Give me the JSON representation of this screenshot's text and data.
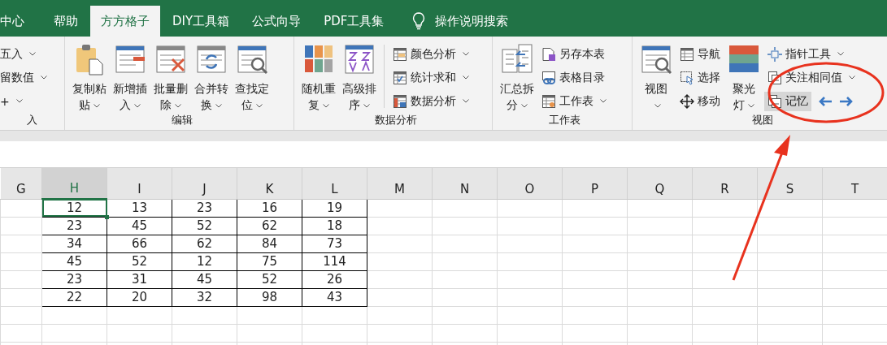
{
  "tabs": [
    {
      "label": "中心",
      "selected": false
    },
    {
      "label": "帮助",
      "selected": false
    },
    {
      "label": "方方格子",
      "selected": true
    },
    {
      "label": "DIY工具箱",
      "selected": false
    },
    {
      "label": "公式向导",
      "selected": false
    },
    {
      "label": "PDF工具集",
      "selected": false
    }
  ],
  "search": {
    "label": "操作说明搜索"
  },
  "ribbon_groups": [
    {
      "label": "入",
      "columns": [
        {
          "kind": "stack",
          "items": [
            {
              "label": "五入",
              "dropdown": true
            },
            {
              "label": "留数值",
              "dropdown": true
            },
            {
              "label": "+",
              "dropdown": true
            }
          ]
        }
      ]
    },
    {
      "label": "编辑",
      "columns": [
        {
          "kind": "large",
          "lines": [
            "复制粘",
            "贴"
          ],
          "dropdown": true
        },
        {
          "kind": "large",
          "lines": [
            "新增插",
            "入"
          ],
          "dropdown": true
        },
        {
          "kind": "large",
          "lines": [
            "批量删",
            "除"
          ],
          "dropdown": true
        },
        {
          "kind": "large",
          "lines": [
            "合并转",
            "换"
          ],
          "dropdown": true
        },
        {
          "kind": "large",
          "lines": [
            "查找定",
            "位"
          ],
          "dropdown": true
        }
      ]
    },
    {
      "label": "数据分析",
      "columns": [
        {
          "kind": "large",
          "lines": [
            "随机重",
            "复"
          ],
          "dropdown": true
        },
        {
          "kind": "large",
          "lines": [
            "高级排",
            "序"
          ],
          "dropdown": true
        },
        {
          "kind": "separator"
        },
        {
          "kind": "stack",
          "items": [
            {
              "label": "颜色分析",
              "dropdown": true
            },
            {
              "label": "统计求和",
              "dropdown": true
            },
            {
              "label": "数据分析",
              "dropdown": true
            }
          ]
        }
      ]
    },
    {
      "label": "工作表",
      "columns": [
        {
          "kind": "large",
          "lines": [
            "汇总拆",
            "分"
          ],
          "dropdown": true
        },
        {
          "kind": "stack",
          "items": [
            {
              "label": "另存本表",
              "dropdown": false
            },
            {
              "label": "表格目录",
              "dropdown": false
            },
            {
              "label": "工作表",
              "dropdown": true
            }
          ]
        }
      ]
    },
    {
      "label": "视图",
      "columns": [
        {
          "kind": "large",
          "lines": [
            "视图"
          ],
          "dropdown": true
        },
        {
          "kind": "stack",
          "items": [
            {
              "label": "导航",
              "dropdown": false
            },
            {
              "label": "选择",
              "dropdown": false
            },
            {
              "label": "移动",
              "dropdown": false
            }
          ]
        },
        {
          "kind": "large",
          "lines": [
            "聚光",
            "灯"
          ],
          "dropdown": true
        },
        {
          "kind": "stack",
          "items": [
            {
              "label": "指针工具",
              "dropdown": true,
              "highlighted": false
            },
            {
              "label": "关注相同值",
              "dropdown": true,
              "highlighted": false
            },
            {
              "label": "记忆",
              "dropdown": false,
              "highlighted": true,
              "nav_arrows": true
            }
          ]
        }
      ]
    }
  ],
  "annotation": {
    "kind": "circle-and-arrow"
  },
  "sheet": {
    "columns": [
      {
        "label": "G",
        "selected": false
      },
      {
        "label": "H",
        "selected": true
      },
      {
        "label": "I",
        "selected": false
      },
      {
        "label": "J",
        "selected": false
      },
      {
        "label": "K",
        "selected": false
      },
      {
        "label": "L",
        "selected": false
      },
      {
        "label": "M",
        "selected": false
      },
      {
        "label": "N",
        "selected": false
      },
      {
        "label": "O",
        "selected": false
      },
      {
        "label": "P",
        "selected": false
      },
      {
        "label": "Q",
        "selected": false
      },
      {
        "label": "R",
        "selected": false
      },
      {
        "label": "S",
        "selected": false
      },
      {
        "label": "T",
        "selected": false
      }
    ],
    "rows": [
      {
        "cells": [
          {
            "selected": false
          },
          {
            "value": "12",
            "selected": true
          },
          {
            "value": "13",
            "selected": false
          },
          {
            "value": "23",
            "selected": false
          },
          {
            "value": "16",
            "selected": false
          },
          {
            "value": "19",
            "selected": false
          }
        ]
      },
      {
        "cells": [
          {
            "selected": false
          },
          {
            "value": "23",
            "selected": false
          },
          {
            "value": "45",
            "selected": false
          },
          {
            "value": "52",
            "selected": false
          },
          {
            "value": "62",
            "selected": false
          },
          {
            "value": "18",
            "selected": false
          }
        ]
      },
      {
        "cells": [
          {
            "selected": false
          },
          {
            "value": "34",
            "selected": false
          },
          {
            "value": "66",
            "selected": false
          },
          {
            "value": "62",
            "selected": false
          },
          {
            "value": "84",
            "selected": false
          },
          {
            "value": "73",
            "selected": false
          }
        ]
      },
      {
        "cells": [
          {
            "selected": false
          },
          {
            "value": "45",
            "selected": false
          },
          {
            "value": "52",
            "selected": false
          },
          {
            "value": "12",
            "selected": false
          },
          {
            "value": "75",
            "selected": false
          },
          {
            "value": "114",
            "selected": false
          }
        ]
      },
      {
        "cells": [
          {
            "selected": false
          },
          {
            "value": "23",
            "selected": false
          },
          {
            "value": "31",
            "selected": false
          },
          {
            "value": "45",
            "selected": false
          },
          {
            "value": "52",
            "selected": false
          },
          {
            "value": "26",
            "selected": false
          }
        ]
      },
      {
        "cells": [
          {
            "selected": false
          },
          {
            "value": "22",
            "selected": false
          },
          {
            "value": "20",
            "selected": false
          },
          {
            "value": "32",
            "selected": false
          },
          {
            "value": "98",
            "selected": false
          },
          {
            "value": "43",
            "selected": false
          }
        ]
      }
    ]
  }
}
